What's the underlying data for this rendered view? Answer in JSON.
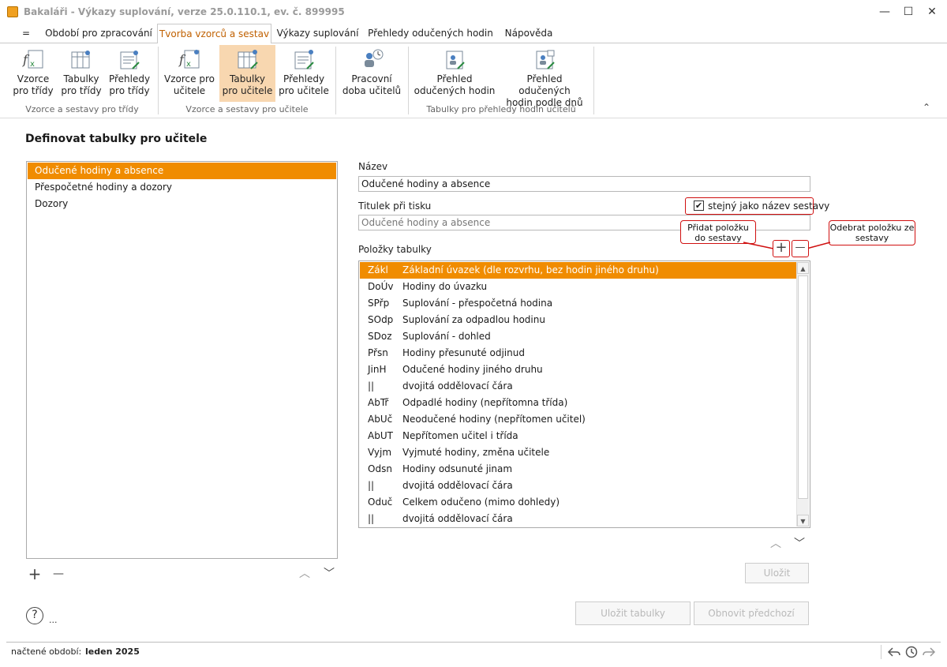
{
  "window": {
    "title": "Bakaláři - Výkazy suplování, verze 25.0.110.1, ev. č. 899995",
    "minimize": "—",
    "maximize": "☐",
    "close": "✕"
  },
  "menu_button": "=",
  "tabs": [
    {
      "label": "Období pro zpracování"
    },
    {
      "label": "Tvorba vzorců a sestav"
    },
    {
      "label": "Výkazy suplování"
    },
    {
      "label": "Přehledy odučených hodin"
    },
    {
      "label": "Nápověda"
    }
  ],
  "ribbon": {
    "buttons": [
      {
        "line1": "Vzorce",
        "line2": "pro třídy"
      },
      {
        "line1": "Tabulky",
        "line2": "pro třídy"
      },
      {
        "line1": "Přehledy",
        "line2": "pro třídy"
      },
      {
        "line1": "Vzorce pro",
        "line2": "učitele"
      },
      {
        "line1": "Tabulky",
        "line2": "pro učitele"
      },
      {
        "line1": "Přehledy",
        "line2": "pro učitele"
      },
      {
        "line1": "Pracovní",
        "line2": "doba učitelů"
      },
      {
        "line1": "Přehled",
        "line2": "odučených hodin"
      },
      {
        "line1": "Přehled odučených",
        "line2": "hodin podle dnů"
      }
    ],
    "groups": [
      "Vzorce a sestavy pro třídy",
      "Vzorce a sestavy pro učitele",
      "Tabulky pro přehledy hodin učitelů"
    ],
    "collapse": "⌃"
  },
  "page_title": "Definovat tabulky pro učitele",
  "tables_list": [
    "Odučené hodiny a absence",
    "Přespočetné hodiny a dozory",
    "Dozory"
  ],
  "left_controls": {
    "add": "+",
    "remove": "—",
    "up": "︿",
    "down": "﹀"
  },
  "form": {
    "name_label": "Název",
    "name_value": "Odučené hodiny a absence",
    "print_title_label": "Titulek při tisku",
    "print_title_value": "Odučené hodiny a absence",
    "same_as_name_label": "stejný jako název sestavy",
    "same_as_name_checked": "✔",
    "items_label": "Položky tabulky"
  },
  "callouts": {
    "add_item": "Přidat položku do sestavy",
    "remove_item": "Odebrat položku ze sestavy"
  },
  "item_controls": {
    "add": "+",
    "remove": "—",
    "up": "︿",
    "down": "﹀"
  },
  "items": [
    {
      "code": "Zákl",
      "desc": "Základní úvazek (dle rozvrhu, bez hodin jiného druhu)"
    },
    {
      "code": "DoÚv",
      "desc": "Hodiny do úvazku"
    },
    {
      "code": "SPřp",
      "desc": "Suplování - přespočetná hodina"
    },
    {
      "code": "SOdp",
      "desc": "Suplování za odpadlou hodinu"
    },
    {
      "code": "SDoz",
      "desc": "Suplování - dohled"
    },
    {
      "code": "Přsn",
      "desc": "Hodiny přesunuté odjinud"
    },
    {
      "code": "JinH",
      "desc": "Odučené hodiny jiného druhu"
    },
    {
      "code": "||",
      "desc": "dvojitá oddělovací čára"
    },
    {
      "code": "AbTř",
      "desc": "Odpadlé hodiny (nepřítomna třída)"
    },
    {
      "code": "AbUč",
      "desc": "Neodučené hodiny (nepřítomen učitel)"
    },
    {
      "code": "AbUT",
      "desc": "Nepřítomen učitel i třída"
    },
    {
      "code": "Vyjm",
      "desc": "Vyjmuté hodiny, změna učitele"
    },
    {
      "code": "Odsn",
      "desc": "Hodiny odsunuté jinam"
    },
    {
      "code": "||",
      "desc": "dvojitá oddělovací čára"
    },
    {
      "code": "Oduč",
      "desc": "Celkem odučeno (mimo dohledy)"
    },
    {
      "code": "||",
      "desc": "dvojitá oddělovací čára"
    }
  ],
  "buttons": {
    "save": "Uložit",
    "save_tables": "Uložit tabulky",
    "restore_previous": "Obnovit předchozí"
  },
  "help": {
    "icon_label": "?",
    "ellipsis": "..."
  },
  "status": {
    "label": "načtené období:",
    "value": "leden 2025"
  },
  "colors": {
    "accent": "#f08c00",
    "active_ribbon": "#f8d7b0",
    "callout_border": "#d01010"
  }
}
